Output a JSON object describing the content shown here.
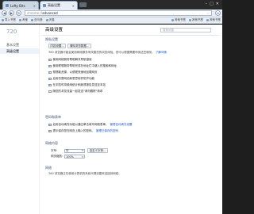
{
  "tabs": [
    {
      "label": "Lofty Bits",
      "active": false
    },
    {
      "label": "高级设置",
      "active": true
    }
  ],
  "address": {
    "scheme": "chrome://",
    "path": "advanced"
  },
  "bookmarks": {
    "left": [
      "导入书签",
      "淘宝",
      "亚马逊",
      "天猫"
    ],
    "right": [
      "其他书签",
      "其他书签",
      "其他书签"
    ]
  },
  "sidebar": {
    "logo": "720",
    "items": [
      {
        "label": "基本设置",
        "active": false
      },
      {
        "label": "高级设置",
        "active": true
      }
    ]
  },
  "main": {
    "title": "高级设置",
    "search_placeholder": "搜索设置",
    "privacy": {
      "title": "隐私设置",
      "content_settings_btn": "内容设置...",
      "clear_data_btn": "清除浏览数据...",
      "description": "360 浏览器可能会使用网络服务来改善您的浏览体验。您可以根据需要停用这些服务。",
      "learn_more": "了解详情",
      "options": [
        {
          "label": "使用网络服务帮助解决导航错误",
          "checked": true
        },
        {
          "label": "使用联想服务帮助完成在地址栏中键入的搜索和网址",
          "checked": true
        },
        {
          "label": "预提取资源，以便更快速地加载网页",
          "checked": true
        },
        {
          "label": "启用仿冒网站和恶意软件防护功能",
          "checked": true
        },
        {
          "label": "在浏览时将使用统计和崩溃报告发送至本站",
          "checked": true
        },
        {
          "label": "随您的浏览流量一起发送\"请勿跟踪\"请求",
          "checked": false
        }
      ]
    },
    "passwords": {
      "title": "密码和表单",
      "options": [
        {
          "label": "启用自动填充功能以通过单击填写网络表单。",
          "link": "管理自动填充设置",
          "checked": true
        },
        {
          "label": "提示保存您在网页上输入的密码。",
          "link": "管理已保存的密码",
          "checked": true
        }
      ]
    },
    "web_content": {
      "title": "网络内容",
      "rows": [
        {
          "label": "字号：",
          "value": "中",
          "button": "自定义字体..."
        },
        {
          "label": "网页缩放：",
          "value": "100%"
        }
      ]
    },
    "network": {
      "title": "网络",
      "description": "360 浏览器正在使用计算机的系统代理设置来连接到网络。"
    }
  }
}
